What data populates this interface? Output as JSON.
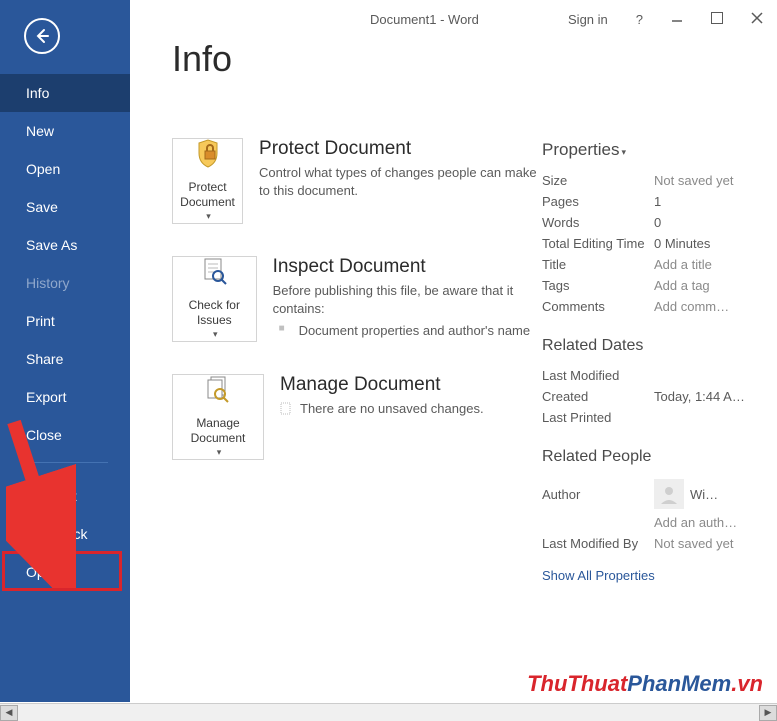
{
  "titlebar": {
    "doc_title": "Document1 - Word",
    "sign_in": "Sign in",
    "help": "?"
  },
  "nav": {
    "items": [
      {
        "label": "Info",
        "active": true
      },
      {
        "label": "New"
      },
      {
        "label": "Open"
      },
      {
        "label": "Save"
      },
      {
        "label": "Save As"
      },
      {
        "label": "History",
        "dim": true
      },
      {
        "label": "Print"
      },
      {
        "label": "Share"
      },
      {
        "label": "Export"
      },
      {
        "label": "Close"
      },
      {
        "label": "Account",
        "after_divider": true
      },
      {
        "label": "Feedback"
      },
      {
        "label": "Options",
        "highlight": true
      }
    ]
  },
  "page_title": "Info",
  "protect": {
    "btn_label": "Protect Document",
    "title": "Protect Document",
    "desc": "Control what types of changes people can make to this document."
  },
  "inspect": {
    "btn_label": "Check for Issues",
    "title": "Inspect Document",
    "desc": "Before publishing this file, be aware that it contains:",
    "item1": "Document properties and author's name"
  },
  "manage": {
    "btn_label": "Manage Document",
    "title": "Manage Document",
    "desc": "There are no unsaved changes."
  },
  "properties": {
    "header": "Properties",
    "rows": {
      "size_k": "Size",
      "size_v": "Not saved yet",
      "pages_k": "Pages",
      "pages_v": "1",
      "words_k": "Words",
      "words_v": "0",
      "time_k": "Total Editing Time",
      "time_v": "0 Minutes",
      "title_k": "Title",
      "title_v": "Add a title",
      "tags_k": "Tags",
      "tags_v": "Add a tag",
      "comments_k": "Comments",
      "comments_v": "Add comm…"
    },
    "dates_header": "Related Dates",
    "dates": {
      "modified_k": "Last Modified",
      "modified_v": "",
      "created_k": "Created",
      "created_v": "Today, 1:44 A…",
      "printed_k": "Last Printed",
      "printed_v": ""
    },
    "people_header": "Related People",
    "people": {
      "author_k": "Author",
      "author_v": "Wi…",
      "add_author": "Add an auth…",
      "lastmod_k": "Last Modified By",
      "lastmod_v": "Not saved yet"
    },
    "show_all": "Show All Properties"
  },
  "watermark": {
    "a": "ThuThuat",
    "b": "PhanMem",
    "c": ".vn"
  }
}
